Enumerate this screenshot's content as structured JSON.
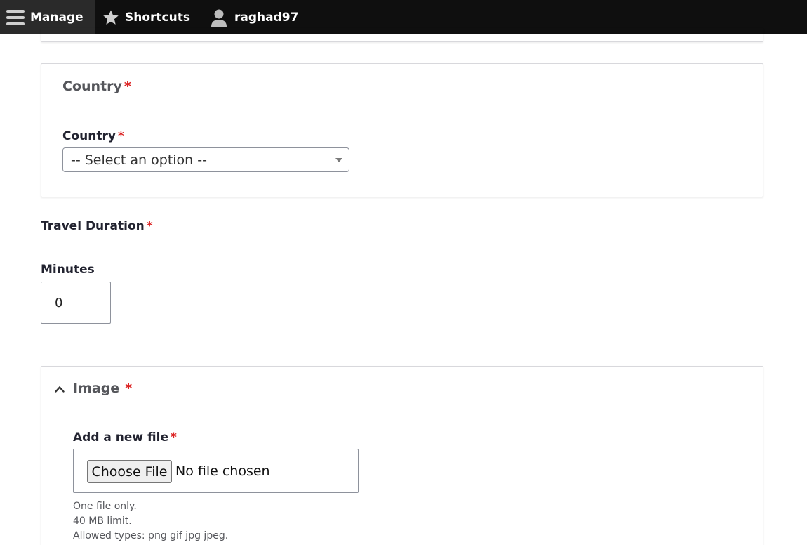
{
  "toolbar": {
    "manage_label": "Manage",
    "shortcuts_label": "Shortcuts",
    "user_label": "raghad97"
  },
  "country_section": {
    "legend": "Country",
    "field_label": "Country",
    "select_value": "-- Select an option --"
  },
  "travel_duration": {
    "label": "Travel Duration",
    "minutes_label": "Minutes",
    "minutes_value": "0"
  },
  "image_section": {
    "legend": "Image",
    "add_file_label": "Add a new file",
    "choose_button": "Choose File",
    "file_status": "No file chosen",
    "desc_1": "One file only.",
    "desc_2": "40 MB limit.",
    "desc_3": "Allowed types: png gif jpg jpeg."
  },
  "required_mark": "*",
  "colors": {
    "toolbar_bg": "#0f0f0f",
    "required": "#dc2323"
  }
}
